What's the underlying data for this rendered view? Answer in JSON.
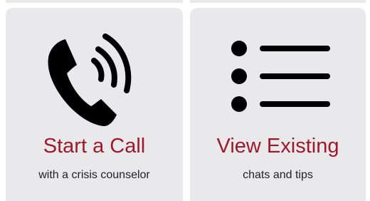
{
  "tiles": [
    {
      "icon": "phone-call-icon",
      "title": "Start a Call",
      "subtitle": "with a crisis counselor"
    },
    {
      "icon": "list-icon",
      "title": "View Existing",
      "subtitle": "chats and tips"
    }
  ],
  "colors": {
    "tile_background": "#e9e9ec",
    "title": "#9e1a2a",
    "subtitle": "#222222",
    "icon": "#000000"
  }
}
